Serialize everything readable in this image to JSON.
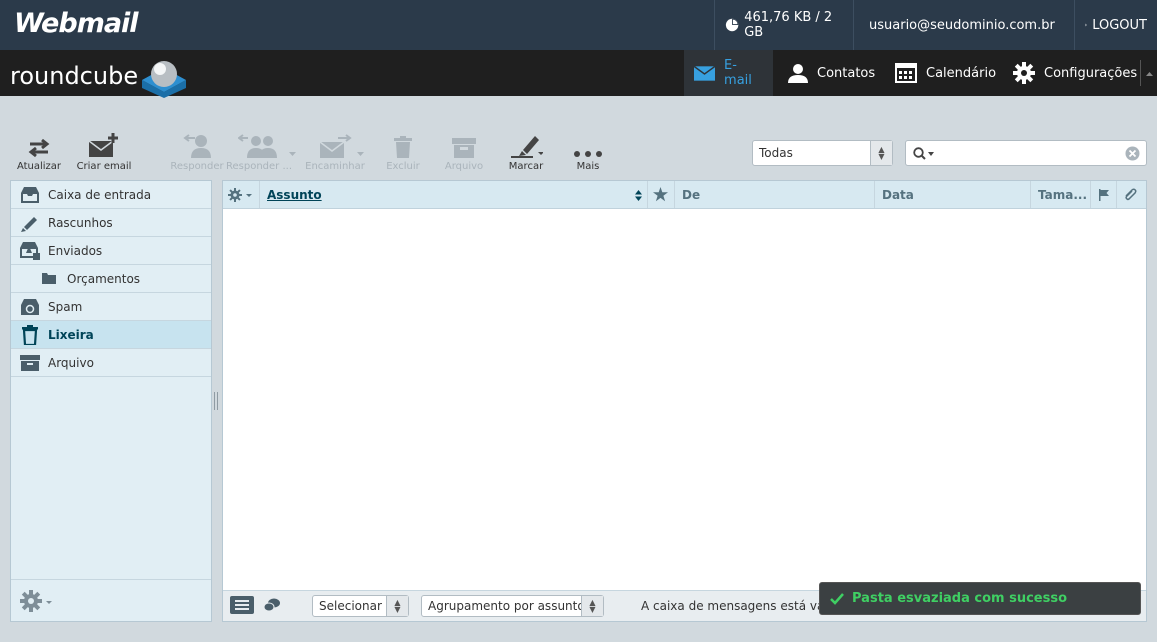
{
  "topbar": {
    "brand": "Webmail",
    "quota": "461,76 KB / 2 GB",
    "user": "usuario@seudominio.com.br",
    "logout": "LOGOUT"
  },
  "navbar": {
    "logo": "roundcube",
    "items": [
      {
        "label": "E-mail",
        "icon": "envelope-icon",
        "active": true
      },
      {
        "label": "Contatos",
        "icon": "person-icon"
      },
      {
        "label": "Calendário",
        "icon": "calendar-icon"
      },
      {
        "label": "Configurações",
        "icon": "gear-icon"
      }
    ]
  },
  "toolbar": {
    "refresh": "Atualizar",
    "compose": "Criar email",
    "reply": "Responder",
    "reply_all": "Responder ...",
    "forward": "Encaminhar",
    "delete": "Excluir",
    "archive": "Arquivo",
    "mark": "Marcar",
    "more": "Mais",
    "filter_value": "Todas"
  },
  "folders": [
    {
      "label": "Caixa de entrada",
      "icon": "inbox-icon"
    },
    {
      "label": "Rascunhos",
      "icon": "pencil-icon"
    },
    {
      "label": "Enviados",
      "icon": "sent-icon"
    },
    {
      "label": "Orçamentos",
      "icon": "folder-icon",
      "sub": true
    },
    {
      "label": "Spam",
      "icon": "spam-icon"
    },
    {
      "label": "Lixeira",
      "icon": "trash-icon",
      "active": true
    },
    {
      "label": "Arquivo",
      "icon": "archive-icon"
    }
  ],
  "list": {
    "columns": {
      "subject": "Assunto",
      "from": "De",
      "date": "Data",
      "size": "Tama..."
    },
    "footer": {
      "select": "Selecionar",
      "threads": "Agrupamento por assunto",
      "status": "A caixa de mensagens está vazia"
    }
  },
  "toast": "Pasta esvaziada com sucesso",
  "colors": {
    "topbar": "#2b3a4a",
    "navbar": "#1f1f1f",
    "accent": "#37a0e0",
    "toast_text": "#3fcf63"
  }
}
